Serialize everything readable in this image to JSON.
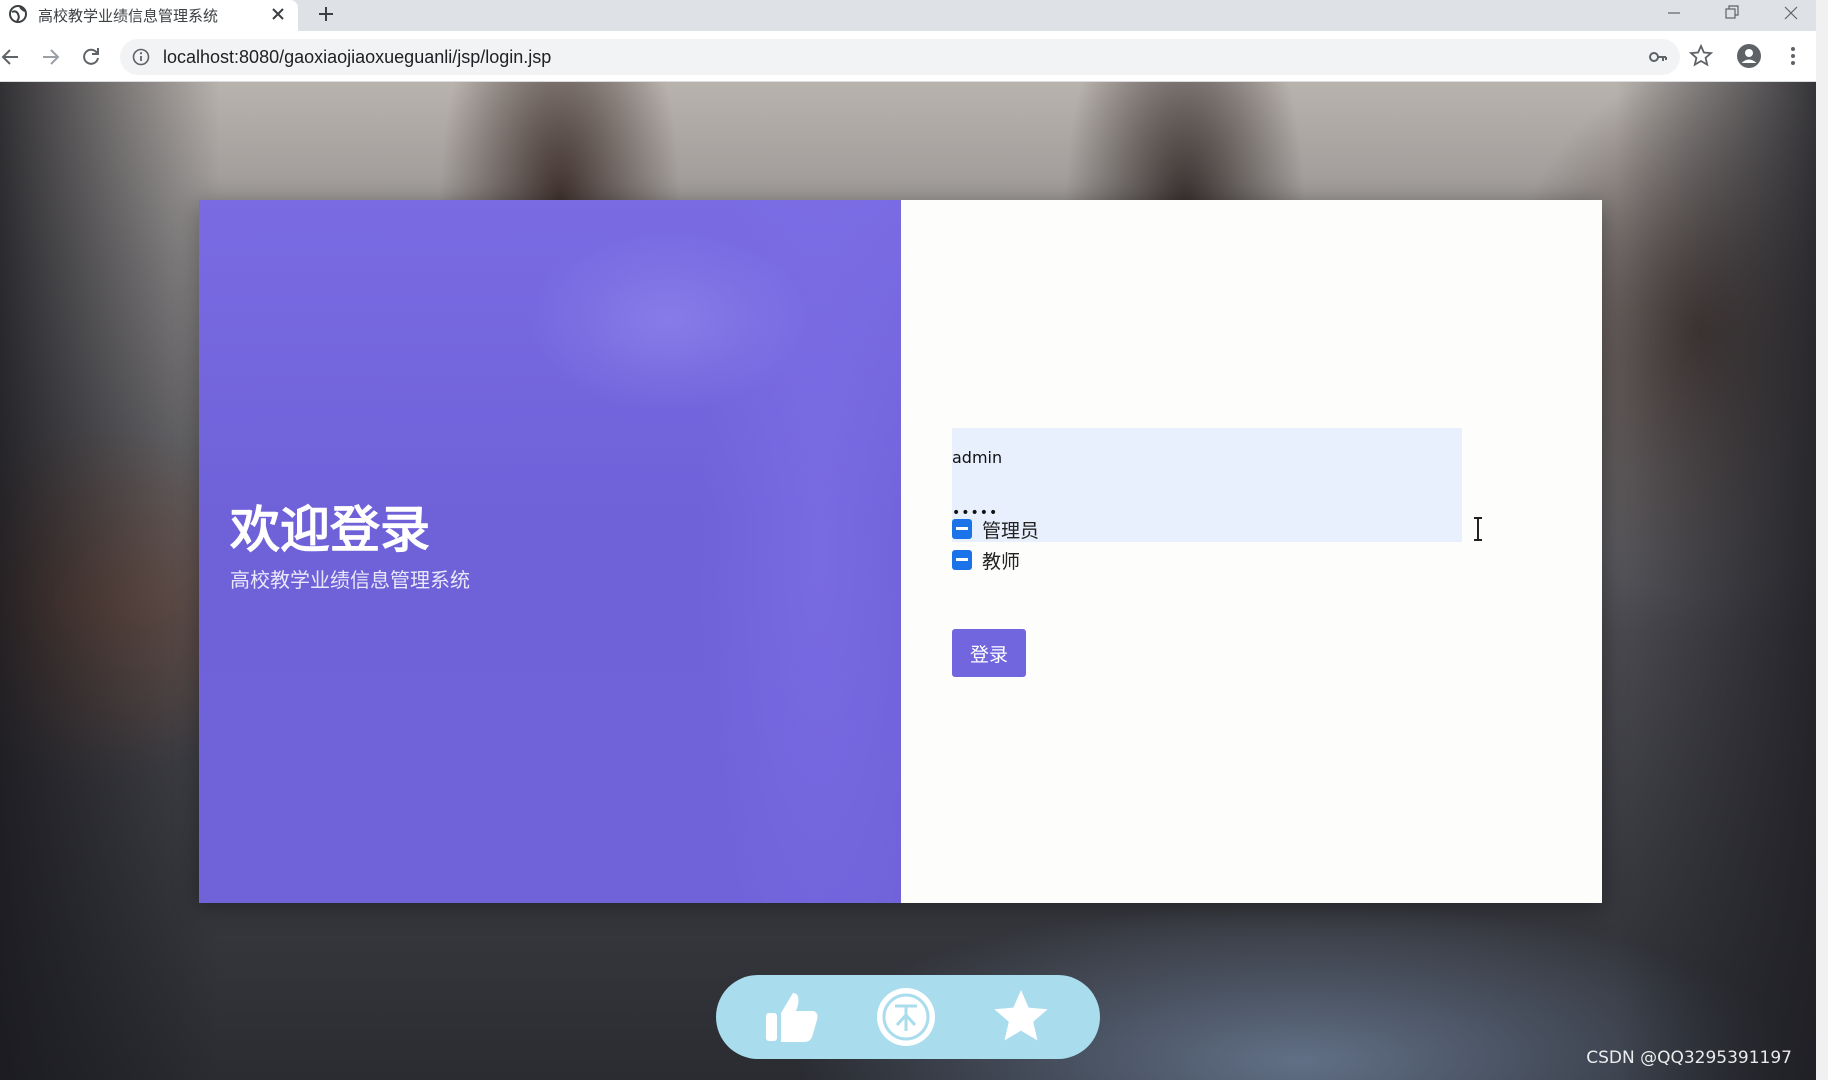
{
  "browser": {
    "tab_title": "高校教学业绩信息管理系统",
    "url": "localhost:8080/gaoxiaojiaoxueguanli/jsp/login.jsp"
  },
  "login": {
    "welcome_title": "欢迎登录",
    "system_name": "高校教学业绩信息管理系统",
    "username_value": "admin",
    "password_value": "•••••",
    "roles": [
      {
        "label": "管理员",
        "checked": "indeterminate"
      },
      {
        "label": "教师",
        "checked": "indeterminate"
      }
    ],
    "login_button_label": "登录"
  },
  "overlay": {
    "actions": [
      "thumbs-up-icon",
      "coin-icon",
      "star-icon"
    ]
  },
  "watermark": "CSDN @QQ3295391197",
  "colors": {
    "accent": "#7266df",
    "panel": "#6f61d8",
    "checkbox": "#1a73e8",
    "input_bg": "#e8effd",
    "pill": "#a9dced"
  }
}
